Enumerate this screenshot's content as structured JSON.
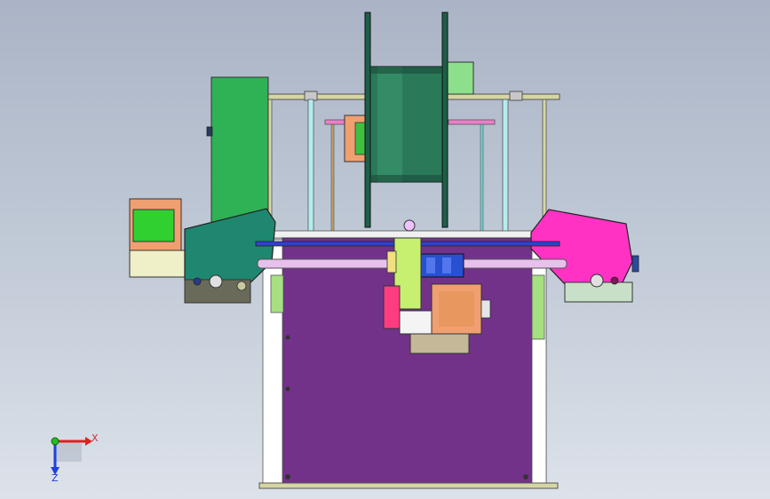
{
  "viewport": {
    "background_top": "#aab4c6",
    "background_bottom": "#dde2ea"
  },
  "model": {
    "colors": {
      "bed": "#72328a",
      "frame_rod": "#d3d3a0",
      "left_plate": "#1f8670",
      "right_plate": "#ff32c4",
      "spool": "#1d5f48",
      "spool_holder": "#2fb156",
      "carriage": "#c8f070",
      "motor": "#f0a070",
      "motor_front": "#30d030",
      "x_rod": "#e8b8e8",
      "z_rod": "#a8e8e8",
      "cable_chain": "#2850d0",
      "blue_bar": "#3040d0"
    }
  },
  "triad": {
    "x_label": "X",
    "z_label": "Z",
    "x_color": "#e02020",
    "y_color": "#20c020",
    "z_color": "#2040e0"
  }
}
